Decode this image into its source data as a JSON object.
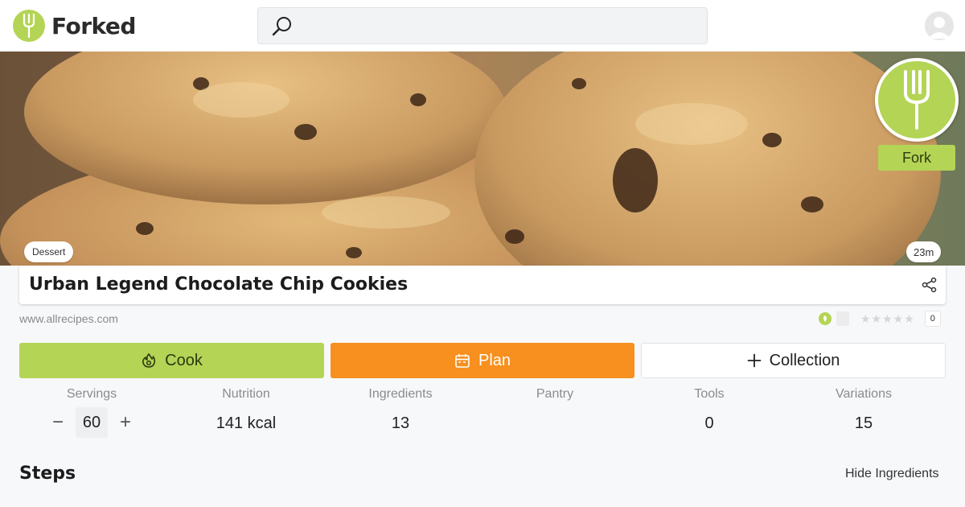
{
  "app": {
    "name": "Forked"
  },
  "search": {
    "placeholder": ""
  },
  "recipe": {
    "category": "Dessert",
    "time": "23m",
    "title": "Urban Legend Chocolate Chip Cookies",
    "source": "www.allrecipes.com",
    "rating_count": "0",
    "fork_label": "Fork"
  },
  "actions": {
    "cook": "Cook",
    "plan": "Plan",
    "collection": "Collection"
  },
  "stats": {
    "servings": {
      "label": "Servings",
      "value": "60",
      "minus": "−",
      "plus": "+"
    },
    "nutrition": {
      "label": "Nutrition",
      "value": "141 kcal"
    },
    "ingredients": {
      "label": "Ingredients",
      "value": "13"
    },
    "pantry": {
      "label": "Pantry",
      "value": ""
    },
    "tools": {
      "label": "Tools",
      "value": "0"
    },
    "variations": {
      "label": "Variations",
      "value": "15"
    }
  },
  "steps": {
    "heading": "Steps",
    "toggle": "Hide Ingredients"
  },
  "icons": {
    "logo": "fork-icon",
    "search": "search-icon",
    "avatar": "user-avatar-icon",
    "share": "share-icon",
    "cook": "flame-icon",
    "plan": "calendar-icon",
    "collection": "plus-icon"
  },
  "colors": {
    "brand_green": "#b4d455",
    "plan_orange": "#f7901e"
  }
}
